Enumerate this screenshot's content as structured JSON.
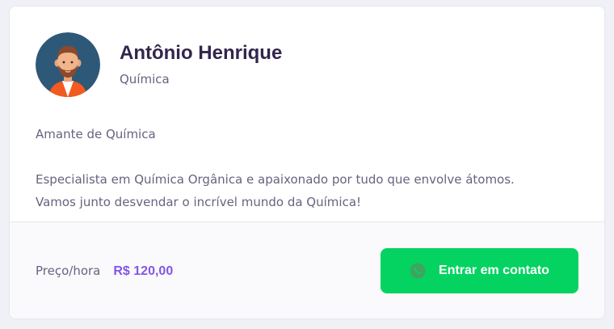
{
  "teacher": {
    "name": "Antônio Henrique",
    "subject": "Química",
    "avatar_icon": "person-avatar-icon",
    "bio": [
      "Amante de Química",
      "Especialista em Química Orgânica e apaixonado por tudo que envolve átomos.\nVamos junto desvendar o incrível mundo da Química!"
    ]
  },
  "footer": {
    "price_label": "Preço/hora",
    "price_value": "R$ 120,00",
    "contact_button_label": "Entrar em contato",
    "contact_icon": "whatsapp-icon"
  },
  "colors": {
    "title": "#32264d",
    "text": "#6a6180",
    "accent": "#8257e5",
    "button": "#04d361",
    "footer_bg": "#fafafc"
  }
}
